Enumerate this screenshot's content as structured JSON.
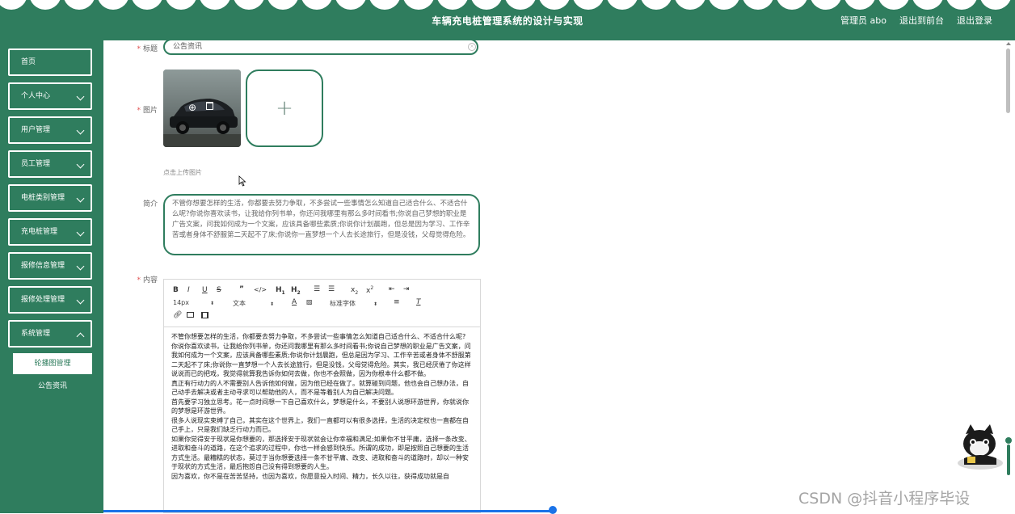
{
  "header": {
    "title": "车辆充电桩管理系统的设计与实现",
    "admin": "管理员 abo",
    "to_front": "退出到前台",
    "logout": "退出登录"
  },
  "sidebar": {
    "items": [
      {
        "label": "首页"
      },
      {
        "label": "个人中心"
      },
      {
        "label": "用户管理"
      },
      {
        "label": "员工管理"
      },
      {
        "label": "电桩类别管理"
      },
      {
        "label": "充电桩管理"
      },
      {
        "label": "报修信息管理"
      },
      {
        "label": "报修处理管理"
      },
      {
        "label": "系统管理"
      }
    ],
    "sub_items": [
      {
        "label": "轮播图管理"
      },
      {
        "label": "公告资讯"
      }
    ]
  },
  "form": {
    "title_label": "标题",
    "title_value": "公告资讯",
    "image_label": "图片",
    "upload_hint": "点击上传图片",
    "intro_label": "简介",
    "intro_text": "不管你想要怎样的生活，你都要去努力争取，不多尝试一些事情怎么知道自己适合什么、不适合什么呢?你说你喜欢读书，让我给你列书单，你还问我哪里有那么多时间看书;你说自己梦想的职业是广告文案，问我如何成为一个文案，应该具备哪些素质;你说你计划晨跑，但总是因为学习、工作辛苦或者身体不舒服第二天起不了床;你说你一直梦想一个人去长途旅行，但是没钱，父母觉得危险。",
    "content_label": "内容"
  },
  "editor": {
    "font_size": "14px",
    "text_type": "文本",
    "font_family": "标准字体",
    "paragraphs": [
      "不管你想要怎样的生活，你都要去努力争取，不多尝试一些事情怎么知道自己适合什么、不适合什么呢?",
      "你说你喜欢读书，让我给你列书单，你还问我哪里有那么多时间看书;你说自己梦想的职业是广告文案，问我如何成为一个文案，应该具备哪些素质;你说你计划晨跑，但总是因为学习、工作辛苦或者身体不舒服第二天起不了床;你说你一直梦想一个人去长途旅行，但是没钱，父母觉得危险。其实，我已经厌倦了你这样说说而已的把戏，我觉得就算我告诉你如何去做，你也不会照做，因为你根本什么都不做。",
      "真正有行动力的人不需要别人告诉他如何做，因为他已经在做了。就算碰到问题，他也会自己想办法，自己动手去解决或者主动寻求可以帮助他的人，而不是等着别人为自己解决问题。",
      "首先要学习独立思考。花一点时间想一下自己喜欢什么，梦想是什么，不要别人说想环游世界，你就说你的梦想是环游世界。",
      "很多人说现实束缚了自己，其实在这个世界上，我们一直都可以有很多选择，生活的决定权也一直都在自己手上，只是我们缺乏行动力而已。",
      "如果你觉得安于现状是你想要的，那选择安于现状就会让你幸福和满足;如果你不甘平庸，选择一条改变、进取和奋斗的道路，在这个追求的过程中，你也一样会感到快乐。所谓的成功，即是按照自己想要的生活方式生活。最糟糕的状态，莫过于当你想要选择一条不甘平庸、改变、进取和奋斗的道路时，却以一种安于现状的方式生活，最后抱怨自己没有得到想要的人生。",
      "因为喜欢，你不是在苦苦坚持，也因为喜欢，你愿意投入时间、精力，长久以往，获得成功就是自"
    ]
  },
  "watermark": "CSDN @抖音小程序毕设"
}
